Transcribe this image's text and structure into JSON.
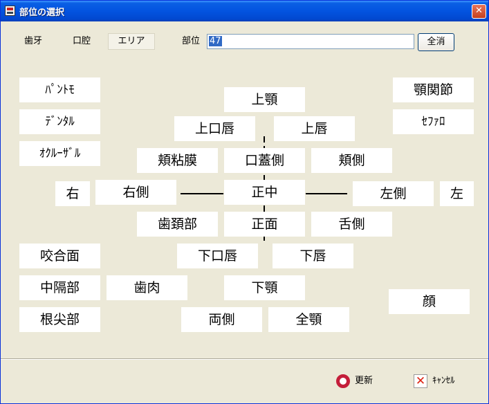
{
  "window": {
    "title": "部位の選択",
    "close_glyph": "✕"
  },
  "header": {
    "tab_teeth": "歯牙",
    "tab_oral": "口腔",
    "tab_area": "エリア",
    "bui_label": "部位",
    "bui_value": "47",
    "clear_label": "全消"
  },
  "parts": {
    "panto": "ﾊﾟﾝﾄﾓ",
    "dental": "ﾃﾞﾝﾀﾙ",
    "occlusal": "ｵｸﾙｰｻﾞﾙ",
    "tmj": "顎関節",
    "cepha": "ｾﾌｧﾛ",
    "upper_jaw": "上顎",
    "upper_oral_lip": "上口唇",
    "upper_lip": "上唇",
    "buccal_mucosa": "頬粘膜",
    "palatal": "口蓋側",
    "buccal": "頬側",
    "right": "右",
    "right_side": "右側",
    "median": "正中",
    "left_side": "左側",
    "left": "左",
    "cervical": "歯頚部",
    "front": "正面",
    "lingual": "舌側",
    "occlusal_surface": "咬合面",
    "lower_oral_lip": "下口唇",
    "lower_lip": "下唇",
    "interproximal": "中隔部",
    "gingiva": "歯肉",
    "lower_jaw": "下顎",
    "face": "顔",
    "apex": "根尖部",
    "both_sides": "両側",
    "full_jaw": "全顎"
  },
  "footer": {
    "update_label": "更新",
    "cancel_label": "ｷｬﾝｾﾙ"
  }
}
